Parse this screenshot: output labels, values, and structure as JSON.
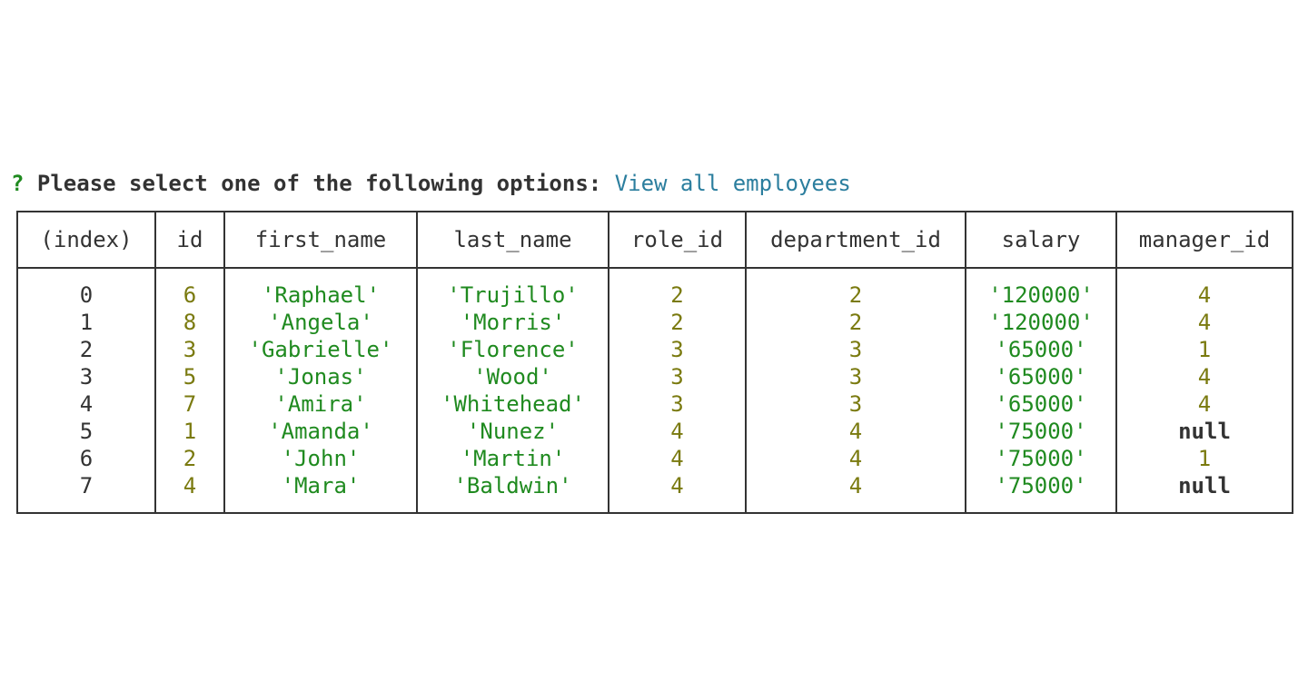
{
  "prompt": {
    "mark": "?",
    "question": "Please select one of the following options:",
    "answer": "View all employees"
  },
  "table": {
    "columns": [
      "(index)",
      "id",
      "first_name",
      "last_name",
      "role_id",
      "department_id",
      "salary",
      "manager_id"
    ],
    "rows": [
      [
        "0",
        "6",
        "'Raphael'",
        "'Trujillo'",
        "2",
        "2",
        "'120000'",
        "4"
      ],
      [
        "1",
        "8",
        "'Angela'",
        "'Morris'",
        "2",
        "2",
        "'120000'",
        "4"
      ],
      [
        "2",
        "3",
        "'Gabrielle'",
        "'Florence'",
        "3",
        "3",
        "'65000'",
        "1"
      ],
      [
        "3",
        "5",
        "'Jonas'",
        "'Wood'",
        "3",
        "3",
        "'65000'",
        "4"
      ],
      [
        "4",
        "7",
        "'Amira'",
        "'Whitehead'",
        "3",
        "3",
        "'65000'",
        "4"
      ],
      [
        "5",
        "1",
        "'Amanda'",
        "'Nunez'",
        "4",
        "4",
        "'75000'",
        "null"
      ],
      [
        "6",
        "2",
        "'John'",
        "'Martin'",
        "4",
        "4",
        "'75000'",
        "1"
      ],
      [
        "7",
        "4",
        "'Mara'",
        "'Baldwin'",
        "4",
        "4",
        "'75000'",
        "null"
      ]
    ]
  },
  "colors": {
    "number": "#7a7a0f",
    "string": "#1f8a1f",
    "answer": "#2b7e9e",
    "border": "#333333"
  }
}
